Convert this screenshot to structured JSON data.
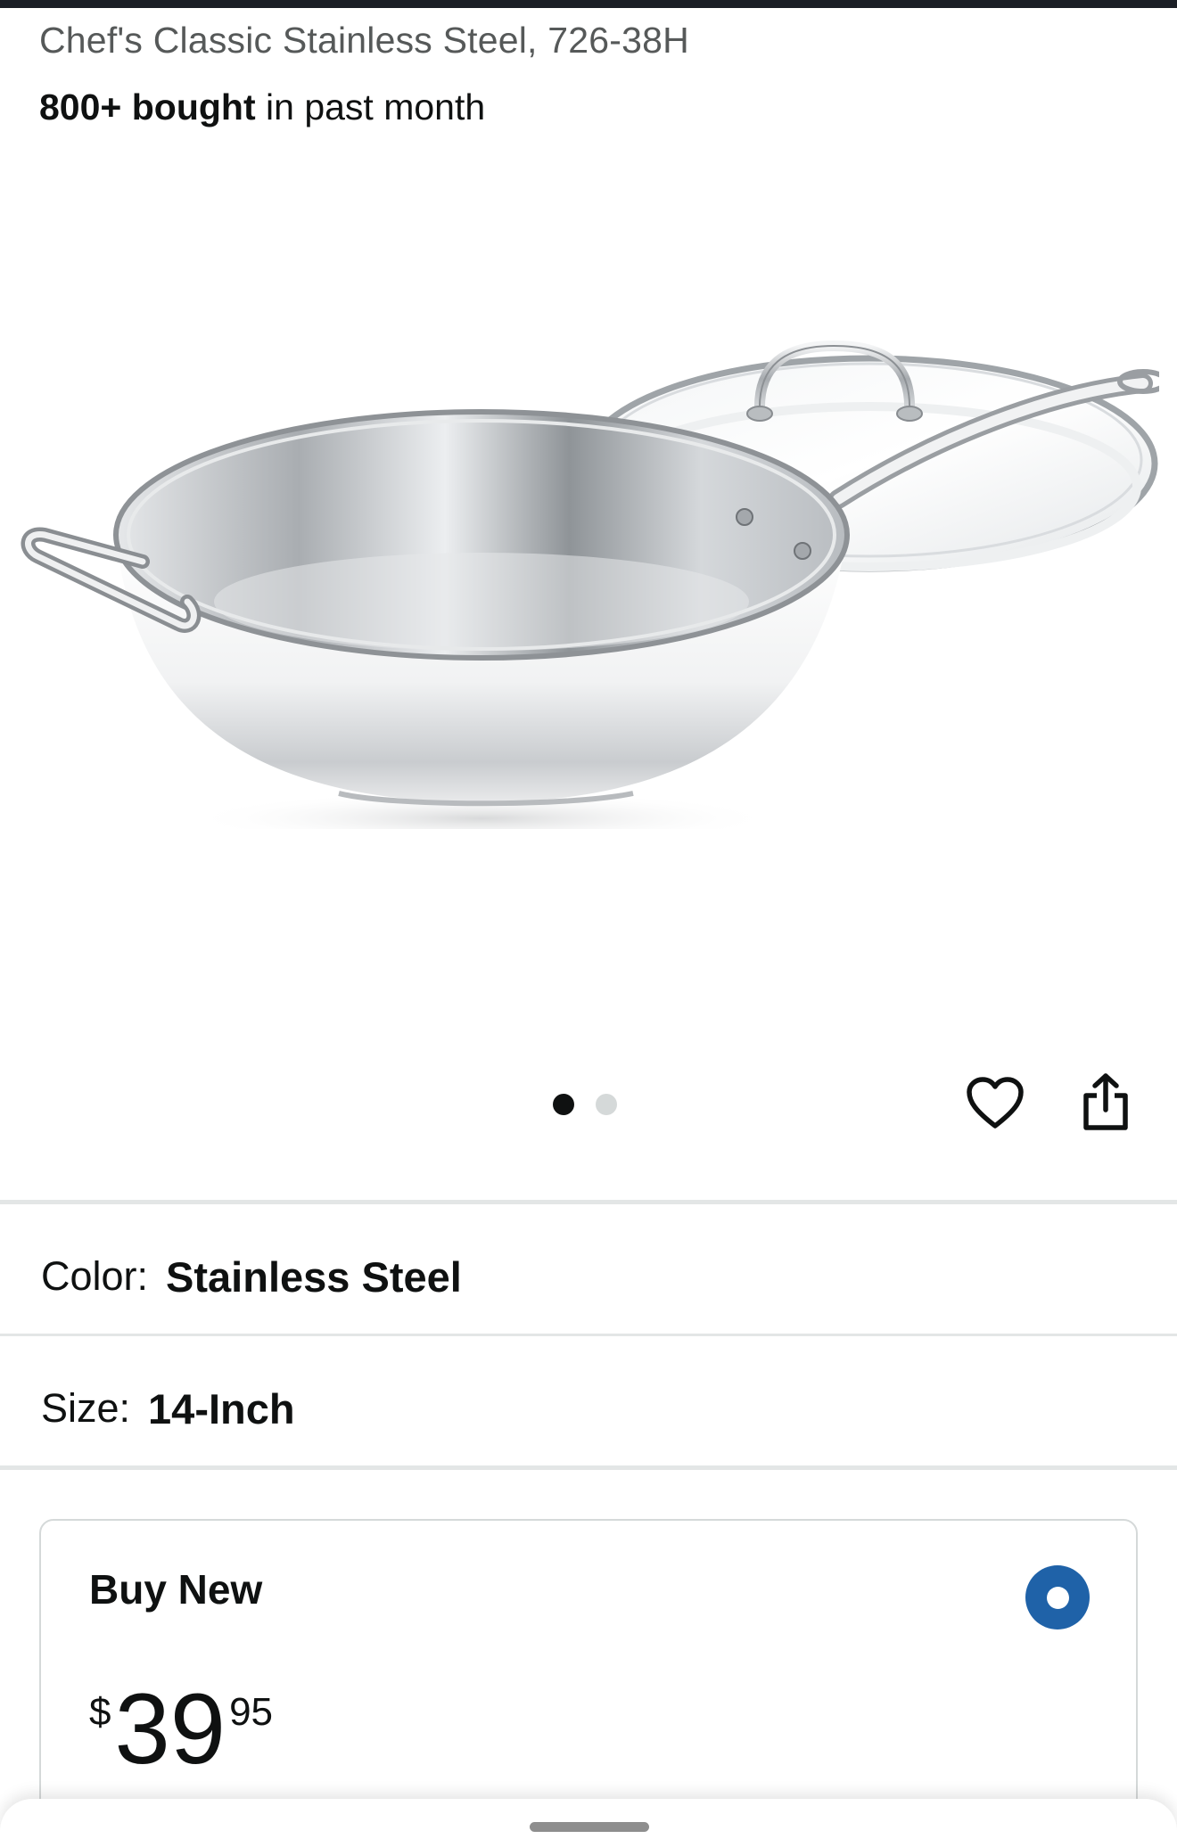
{
  "product": {
    "title_visible": "Chef's Classic Stainless Steel, 726-38H",
    "bought_count": "800+ bought",
    "bought_suffix": " in past month"
  },
  "image_carousel": {
    "total_images": 2,
    "active_index": 0
  },
  "actions": {
    "wishlist_icon": "heart-outline-icon",
    "share_icon": "share-icon"
  },
  "variations": {
    "color_label": "Color:",
    "color_value": "Stainless Steel",
    "size_label": "Size:",
    "size_value": "14-Inch"
  },
  "buy_box": {
    "title": "Buy New",
    "selected": true,
    "price_symbol": "$",
    "price_whole": "39",
    "price_fraction": "95",
    "radio_color": "#1f62a8"
  }
}
